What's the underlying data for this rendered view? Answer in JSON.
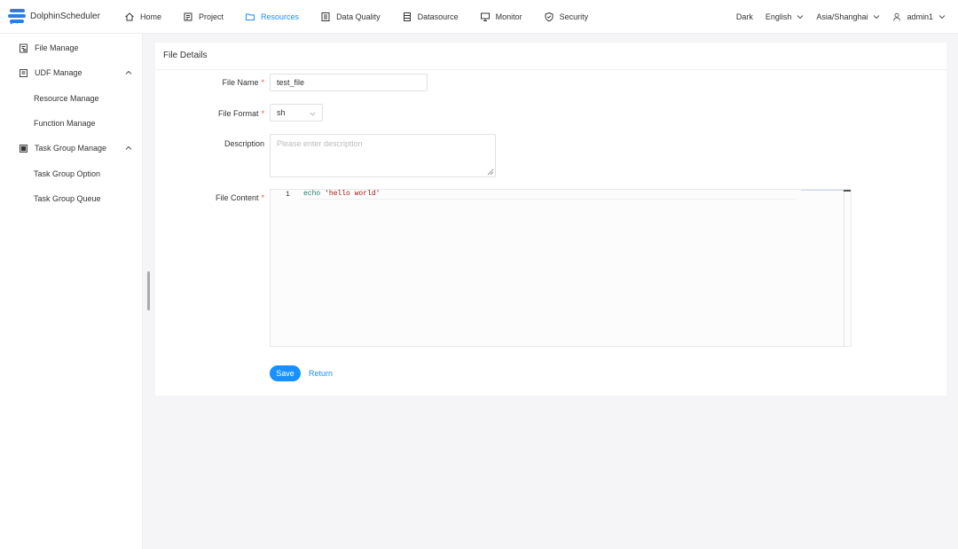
{
  "app": {
    "name": "DolphinScheduler"
  },
  "nav": {
    "items": [
      {
        "label": "Home",
        "icon": "home-icon"
      },
      {
        "label": "Project",
        "icon": "project-icon"
      },
      {
        "label": "Resources",
        "icon": "folder-icon",
        "active": true
      },
      {
        "label": "Data Quality",
        "icon": "data-quality-icon"
      },
      {
        "label": "Datasource",
        "icon": "datasource-icon"
      },
      {
        "label": "Monitor",
        "icon": "monitor-icon"
      },
      {
        "label": "Security",
        "icon": "shield-icon"
      }
    ]
  },
  "header_right": {
    "theme": "Dark",
    "language": "English",
    "timezone": "Asia/Shanghai",
    "user": "admin1"
  },
  "sidebar": {
    "items": [
      {
        "label": "File Manage",
        "icon": "file-manage-icon"
      },
      {
        "label": "UDF Manage",
        "icon": "udf-icon",
        "expanded": true
      },
      {
        "label": "Resource Manage"
      },
      {
        "label": "Function Manage"
      },
      {
        "label": "Task Group Manage",
        "icon": "task-group-icon",
        "expanded": true
      },
      {
        "label": "Task Group Option"
      },
      {
        "label": "Task Group Queue"
      }
    ]
  },
  "form": {
    "title": "File Details",
    "file_name_label": "File Name",
    "file_name_value": "test_file",
    "file_format_label": "File Format",
    "file_format_value": "sh",
    "description_label": "Description",
    "description_placeholder": "Please enter description",
    "file_content_label": "File Content",
    "required_mark": "*",
    "code": {
      "line_number": "1",
      "keyword": "echo",
      "string": "'hello world'"
    },
    "save_label": "Save",
    "return_label": "Return"
  },
  "colors": {
    "accent": "#1890ff",
    "required": "#ee5544"
  }
}
